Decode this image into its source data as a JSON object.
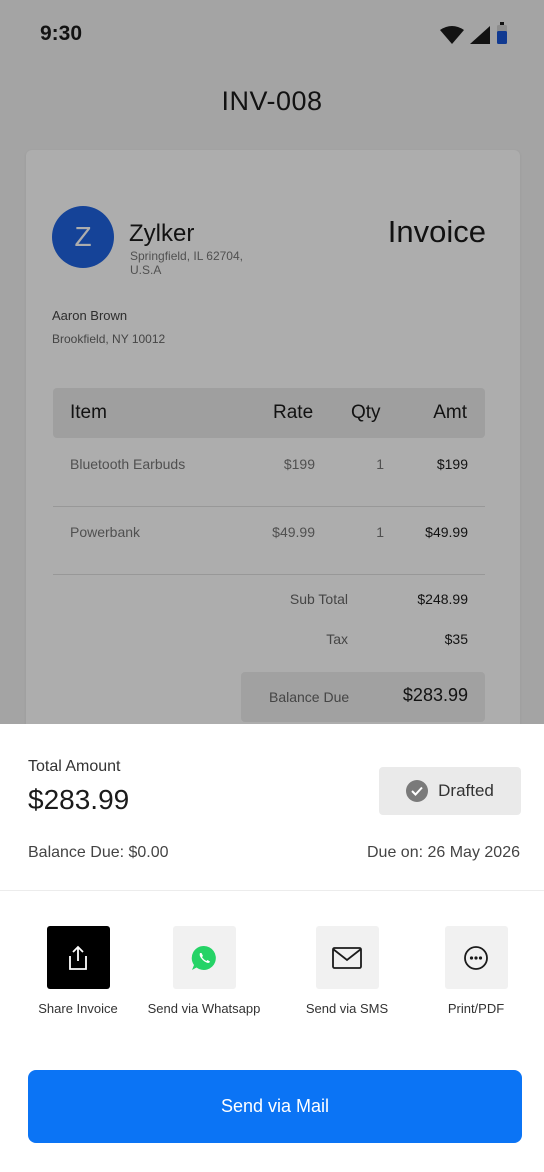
{
  "status_bar": {
    "time": "9:30"
  },
  "header": {
    "title": "INV-008"
  },
  "invoice": {
    "avatar_letter": "Z",
    "company_name": "Zylker",
    "company_address": "Springfield, IL 62704, U.S.A",
    "document_type": "Invoice",
    "bill_to_name": "Aaron Brown",
    "bill_to_address": "Brookfield, NY 10012",
    "columns": [
      "Item",
      "Rate",
      "Qty",
      "Amt"
    ],
    "rows": [
      {
        "item": "Bluetooth Earbuds",
        "rate": "$199",
        "qty": "1",
        "amt": "$199"
      },
      {
        "item": "Powerbank",
        "rate": "$49.99",
        "qty": "1",
        "amt": "$49.99"
      }
    ],
    "sub_total_label": "Sub Total",
    "sub_total_value": "$248.99",
    "tax_label": "Tax",
    "tax_value": "$35",
    "balance_due_label": "Balance Due",
    "balance_due_value": "$283.99"
  },
  "sheet": {
    "total_label": "Total Amount",
    "total_value": "$283.99",
    "status_badge": "Drafted",
    "balance_due_text": "Balance Due: $0.00",
    "due_on_text": "Due on: 26 May 2026",
    "actions": [
      {
        "label": "Share Invoice",
        "icon": "share-icon"
      },
      {
        "label": "Send via Whatsapp",
        "icon": "whatsapp-icon"
      },
      {
        "label": "Send via SMS",
        "icon": "envelope-icon"
      },
      {
        "label": "Print/PDF",
        "icon": "more-icon"
      }
    ],
    "primary_button": "Send via Mail"
  },
  "colors": {
    "accent": "#0b74f5",
    "avatar": "#1f63e0",
    "whatsapp": "#25d366",
    "battery": "#1a56d6"
  }
}
